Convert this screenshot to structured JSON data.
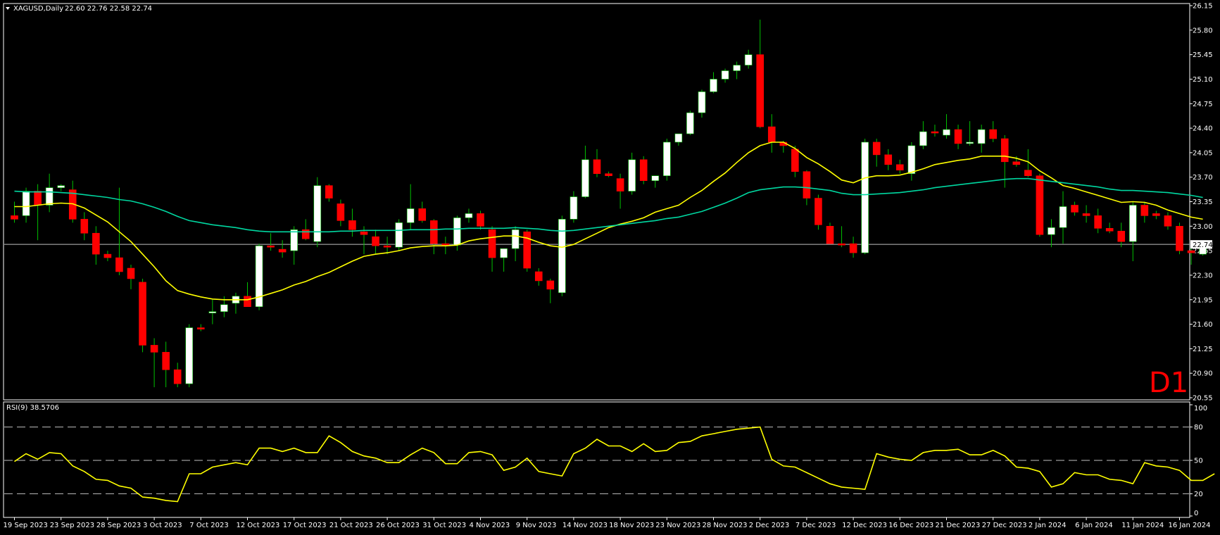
{
  "header": {
    "symbol_timeframe": "XAGUSD,Daily",
    "ohlc": "22.60 22.76 22.58 22.74"
  },
  "timeframe_badge": "D1",
  "colors": {
    "background": "#000000",
    "bull_body": "#ffffff",
    "bear_body": "#ff0000",
    "wick": "#00c000",
    "ma_fast": "#ffff00",
    "ma_slow": "#00d7a0",
    "rsi_line": "#ffff00",
    "axis_text": "#ffffff",
    "frame": "#ffffff",
    "price_line": "#c0c0c0",
    "badge": "#ff0000"
  },
  "chart_data": [
    {
      "type": "candlestick",
      "symbol": "XAGUSD",
      "timeframe": "Daily",
      "last_price": "22.74",
      "y_range": [
        20.55,
        26.15
      ],
      "y_ticks": [
        "26.15",
        "25.80",
        "25.45",
        "25.10",
        "24.75",
        "24.40",
        "24.05",
        "23.70",
        "23.35",
        "23.00",
        "22.65",
        "22.30",
        "21.95",
        "21.60",
        "21.25",
        "20.90",
        "20.55"
      ],
      "x_tick_labels": [
        {
          "index": 0,
          "label": "19 Sep 2023"
        },
        {
          "index": 4,
          "label": "23 Sep 2023"
        },
        {
          "index": 8,
          "label": "28 Sep 2023"
        },
        {
          "index": 12,
          "label": "3 Oct 2023"
        },
        {
          "index": 16,
          "label": "7 Oct 2023"
        },
        {
          "index": 20,
          "label": "12 Oct 2023"
        },
        {
          "index": 24,
          "label": "17 Oct 2023"
        },
        {
          "index": 28,
          "label": "21 Oct 2023"
        },
        {
          "index": 32,
          "label": "26 Oct 2023"
        },
        {
          "index": 36,
          "label": "31 Oct 2023"
        },
        {
          "index": 40,
          "label": "4 Nov 2023"
        },
        {
          "index": 44,
          "label": "9 Nov 2023"
        },
        {
          "index": 48,
          "label": "14 Nov 2023"
        },
        {
          "index": 52,
          "label": "18 Nov 2023"
        },
        {
          "index": 56,
          "label": "23 Nov 2023"
        },
        {
          "index": 60,
          "label": "28 Nov 2023"
        },
        {
          "index": 64,
          "label": "2 Dec 2023"
        },
        {
          "index": 68,
          "label": "7 Dec 2023"
        },
        {
          "index": 72,
          "label": "12 Dec 2023"
        },
        {
          "index": 76,
          "label": "16 Dec 2023"
        },
        {
          "index": 80,
          "label": "21 Dec 2023"
        },
        {
          "index": 84,
          "label": "27 Dec 2023"
        },
        {
          "index": 88,
          "label": "2 Jan 2024"
        },
        {
          "index": 92,
          "label": "6 Jan 2024"
        },
        {
          "index": 96,
          "label": "11 Jan 2024"
        },
        {
          "index": 100,
          "label": "16 Jan 2024"
        }
      ],
      "candles": [
        {
          "o": 23.15,
          "h": 23.35,
          "l": 23.05,
          "c": 23.1
        },
        {
          "o": 23.15,
          "h": 23.55,
          "l": 23.05,
          "c": 23.5
        },
        {
          "o": 23.5,
          "h": 23.6,
          "l": 22.8,
          "c": 23.3
        },
        {
          "o": 23.3,
          "h": 23.75,
          "l": 23.2,
          "c": 23.55
        },
        {
          "o": 23.55,
          "h": 23.6,
          "l": 23.5,
          "c": 23.58
        },
        {
          "o": 23.52,
          "h": 23.65,
          "l": 23.05,
          "c": 23.1
        },
        {
          "o": 23.1,
          "h": 23.2,
          "l": 22.8,
          "c": 22.9
        },
        {
          "o": 22.9,
          "h": 23.0,
          "l": 22.45,
          "c": 22.6
        },
        {
          "o": 22.6,
          "h": 22.65,
          "l": 22.5,
          "c": 22.55
        },
        {
          "o": 22.55,
          "h": 23.55,
          "l": 22.3,
          "c": 22.35
        },
        {
          "o": 22.4,
          "h": 22.45,
          "l": 22.1,
          "c": 22.25
        },
        {
          "o": 22.2,
          "h": 22.25,
          "l": 21.2,
          "c": 21.3
        },
        {
          "o": 21.3,
          "h": 21.4,
          "l": 20.7,
          "c": 21.2
        },
        {
          "o": 21.2,
          "h": 21.35,
          "l": 20.7,
          "c": 20.95
        },
        {
          "o": 20.95,
          "h": 21.05,
          "l": 20.7,
          "c": 20.75
        },
        {
          "o": 20.75,
          "h": 21.6,
          "l": 20.7,
          "c": 21.55
        },
        {
          "o": 21.55,
          "h": 21.6,
          "l": 21.5,
          "c": 21.53
        },
        {
          "o": 21.78,
          "h": 21.95,
          "l": 21.6,
          "c": 21.78
        },
        {
          "o": 21.78,
          "h": 22.0,
          "l": 21.7,
          "c": 21.88
        },
        {
          "o": 21.9,
          "h": 22.05,
          "l": 21.75,
          "c": 22.0
        },
        {
          "o": 22.0,
          "h": 22.2,
          "l": 21.85,
          "c": 21.85
        },
        {
          "o": 21.85,
          "h": 22.75,
          "l": 21.8,
          "c": 22.72
        },
        {
          "o": 22.72,
          "h": 22.9,
          "l": 22.65,
          "c": 22.7
        },
        {
          "o": 22.67,
          "h": 22.8,
          "l": 22.55,
          "c": 22.63
        },
        {
          "o": 22.65,
          "h": 23.0,
          "l": 22.45,
          "c": 22.95
        },
        {
          "o": 22.95,
          "h": 23.1,
          "l": 22.8,
          "c": 22.82
        },
        {
          "o": 22.78,
          "h": 23.7,
          "l": 22.7,
          "c": 23.58
        },
        {
          "o": 23.58,
          "h": 23.6,
          "l": 23.35,
          "c": 23.4
        },
        {
          "o": 23.32,
          "h": 23.38,
          "l": 23.0,
          "c": 23.08
        },
        {
          "o": 23.08,
          "h": 23.25,
          "l": 22.85,
          "c": 22.95
        },
        {
          "o": 22.92,
          "h": 23.0,
          "l": 22.6,
          "c": 22.88
        },
        {
          "o": 22.85,
          "h": 22.95,
          "l": 22.6,
          "c": 22.72
        },
        {
          "o": 22.72,
          "h": 22.85,
          "l": 22.6,
          "c": 22.7
        },
        {
          "o": 22.7,
          "h": 23.1,
          "l": 22.65,
          "c": 23.05
        },
        {
          "o": 23.05,
          "h": 23.6,
          "l": 22.95,
          "c": 23.25
        },
        {
          "o": 23.25,
          "h": 23.35,
          "l": 23.05,
          "c": 23.08
        },
        {
          "o": 23.08,
          "h": 23.1,
          "l": 22.6,
          "c": 22.75
        },
        {
          "o": 22.75,
          "h": 22.85,
          "l": 22.6,
          "c": 22.73
        },
        {
          "o": 22.73,
          "h": 23.15,
          "l": 22.65,
          "c": 23.12
        },
        {
          "o": 23.12,
          "h": 23.25,
          "l": 23.05,
          "c": 23.18
        },
        {
          "o": 23.18,
          "h": 23.22,
          "l": 22.95,
          "c": 23.0
        },
        {
          "o": 22.95,
          "h": 23.0,
          "l": 22.35,
          "c": 22.55
        },
        {
          "o": 22.55,
          "h": 22.65,
          "l": 22.35,
          "c": 22.68
        },
        {
          "o": 22.68,
          "h": 23.0,
          "l": 22.5,
          "c": 22.95
        },
        {
          "o": 22.92,
          "h": 22.95,
          "l": 22.35,
          "c": 22.4
        },
        {
          "o": 22.35,
          "h": 22.4,
          "l": 22.15,
          "c": 22.22
        },
        {
          "o": 22.22,
          "h": 22.25,
          "l": 21.9,
          "c": 22.1
        },
        {
          "o": 22.05,
          "h": 23.15,
          "l": 22.0,
          "c": 23.1
        },
        {
          "o": 23.1,
          "h": 23.5,
          "l": 23.05,
          "c": 23.42
        },
        {
          "o": 23.42,
          "h": 24.15,
          "l": 23.4,
          "c": 23.95
        },
        {
          "o": 23.95,
          "h": 24.1,
          "l": 23.7,
          "c": 23.75
        },
        {
          "o": 23.75,
          "h": 23.78,
          "l": 23.7,
          "c": 23.72
        },
        {
          "o": 23.68,
          "h": 23.75,
          "l": 23.25,
          "c": 23.5
        },
        {
          "o": 23.5,
          "h": 24.05,
          "l": 23.45,
          "c": 23.95
        },
        {
          "o": 23.95,
          "h": 24.0,
          "l": 23.6,
          "c": 23.65
        },
        {
          "o": 23.65,
          "h": 23.7,
          "l": 23.55,
          "c": 23.72
        },
        {
          "o": 23.72,
          "h": 24.25,
          "l": 23.65,
          "c": 24.2
        },
        {
          "o": 24.2,
          "h": 24.3,
          "l": 24.15,
          "c": 24.32
        },
        {
          "o": 24.32,
          "h": 24.65,
          "l": 24.3,
          "c": 24.62
        },
        {
          "o": 24.62,
          "h": 24.95,
          "l": 24.55,
          "c": 24.92
        },
        {
          "o": 24.92,
          "h": 25.2,
          "l": 24.9,
          "c": 25.1
        },
        {
          "o": 25.1,
          "h": 25.25,
          "l": 25.05,
          "c": 25.22
        },
        {
          "o": 25.22,
          "h": 25.35,
          "l": 25.1,
          "c": 25.3
        },
        {
          "o": 25.3,
          "h": 25.52,
          "l": 25.25,
          "c": 25.45
        },
        {
          "o": 25.45,
          "h": 25.95,
          "l": 24.4,
          "c": 24.42
        },
        {
          "o": 24.42,
          "h": 24.6,
          "l": 24.05,
          "c": 24.2
        },
        {
          "o": 24.2,
          "h": 24.22,
          "l": 24.05,
          "c": 24.15
        },
        {
          "o": 24.1,
          "h": 24.15,
          "l": 23.7,
          "c": 23.78
        },
        {
          "o": 23.78,
          "h": 23.8,
          "l": 23.3,
          "c": 23.4
        },
        {
          "o": 23.4,
          "h": 23.45,
          "l": 22.95,
          "c": 23.02
        },
        {
          "o": 23.0,
          "h": 23.05,
          "l": 22.75,
          "c": 22.75
        },
        {
          "o": 22.75,
          "h": 23.0,
          "l": 22.7,
          "c": 22.73
        },
        {
          "o": 22.75,
          "h": 22.85,
          "l": 22.55,
          "c": 22.62
        },
        {
          "o": 22.62,
          "h": 24.25,
          "l": 22.6,
          "c": 24.2
        },
        {
          "o": 24.2,
          "h": 24.25,
          "l": 23.85,
          "c": 24.02
        },
        {
          "o": 24.02,
          "h": 24.1,
          "l": 23.8,
          "c": 23.88
        },
        {
          "o": 23.88,
          "h": 23.95,
          "l": 23.75,
          "c": 23.8
        },
        {
          "o": 23.75,
          "h": 24.2,
          "l": 23.65,
          "c": 24.15
        },
        {
          "o": 24.15,
          "h": 24.5,
          "l": 24.1,
          "c": 24.35
        },
        {
          "o": 24.35,
          "h": 24.45,
          "l": 24.28,
          "c": 24.33
        },
        {
          "o": 24.3,
          "h": 24.6,
          "l": 24.25,
          "c": 24.38
        },
        {
          "o": 24.38,
          "h": 24.45,
          "l": 24.1,
          "c": 24.18
        },
        {
          "o": 24.2,
          "h": 24.5,
          "l": 24.15,
          "c": 24.2
        },
        {
          "o": 24.18,
          "h": 24.45,
          "l": 24.05,
          "c": 24.38
        },
        {
          "o": 24.38,
          "h": 24.5,
          "l": 24.2,
          "c": 24.25
        },
        {
          "o": 24.25,
          "h": 24.3,
          "l": 23.55,
          "c": 23.92
        },
        {
          "o": 23.92,
          "h": 24.0,
          "l": 23.85,
          "c": 23.88
        },
        {
          "o": 23.8,
          "h": 24.1,
          "l": 23.7,
          "c": 23.72
        },
        {
          "o": 23.72,
          "h": 23.75,
          "l": 22.85,
          "c": 22.88
        },
        {
          "o": 22.88,
          "h": 23.1,
          "l": 22.7,
          "c": 22.98
        },
        {
          "o": 22.98,
          "h": 23.5,
          "l": 22.75,
          "c": 23.28
        },
        {
          "o": 23.3,
          "h": 23.35,
          "l": 23.15,
          "c": 23.2
        },
        {
          "o": 23.18,
          "h": 23.3,
          "l": 23.05,
          "c": 23.15
        },
        {
          "o": 23.15,
          "h": 23.25,
          "l": 22.9,
          "c": 22.97
        },
        {
          "o": 22.97,
          "h": 23.05,
          "l": 22.9,
          "c": 22.93
        },
        {
          "o": 22.93,
          "h": 23.05,
          "l": 22.7,
          "c": 22.78
        },
        {
          "o": 22.78,
          "h": 23.35,
          "l": 22.5,
          "c": 23.3
        },
        {
          "o": 23.3,
          "h": 23.35,
          "l": 23.05,
          "c": 23.15
        },
        {
          "o": 23.18,
          "h": 23.22,
          "l": 23.1,
          "c": 23.15
        },
        {
          "o": 23.15,
          "h": 23.2,
          "l": 22.95,
          "c": 23.0
        },
        {
          "o": 23.0,
          "h": 23.05,
          "l": 22.6,
          "c": 22.65
        },
        {
          "o": 22.65,
          "h": 22.7,
          "l": 22.45,
          "c": 22.62
        },
        {
          "o": 22.6,
          "h": 22.76,
          "l": 22.58,
          "c": 22.74
        }
      ],
      "series": [
        {
          "values": [
            23.28,
            23.28,
            23.3,
            23.32,
            23.33,
            23.32,
            23.26,
            23.16,
            23.06,
            22.92,
            22.78,
            22.6,
            22.42,
            22.22,
            22.08,
            22.03,
            21.99,
            21.96,
            21.95,
            21.95,
            21.95,
            21.99,
            22.04,
            22.09,
            22.16,
            22.21,
            22.28,
            22.34,
            22.42,
            22.5,
            22.57,
            22.6,
            22.62,
            22.65,
            22.69,
            22.71,
            22.72,
            22.72,
            22.73,
            22.79,
            22.82,
            22.84,
            22.86,
            22.86,
            22.83,
            22.77,
            22.72,
            22.7,
            22.74,
            22.82,
            22.9,
            22.98,
            23.03,
            23.07,
            23.12,
            23.2,
            23.25,
            23.3,
            23.41,
            23.51,
            23.64,
            23.76,
            23.91,
            24.05,
            24.15,
            24.2,
            24.2,
            24.11,
            23.98,
            23.89,
            23.78,
            23.66,
            23.62,
            23.69,
            23.72,
            23.72,
            23.73,
            23.77,
            23.82,
            23.88,
            23.91,
            23.94,
            23.96,
            24.0,
            24.0,
            24.0,
            23.97,
            23.92,
            23.79,
            23.69,
            23.58,
            23.54,
            23.49,
            23.44,
            23.39,
            23.34,
            23.35,
            23.34,
            23.3,
            23.23,
            23.18,
            23.13,
            23.1
          ]
        },
        {
          "values": [
            23.5,
            23.49,
            23.49,
            23.49,
            23.48,
            23.47,
            23.45,
            23.43,
            23.41,
            23.38,
            23.36,
            23.32,
            23.27,
            23.21,
            23.14,
            23.08,
            23.05,
            23.02,
            23.0,
            22.98,
            22.95,
            22.93,
            22.92,
            22.92,
            22.92,
            22.92,
            22.92,
            22.92,
            22.93,
            22.93,
            22.94,
            22.94,
            22.94,
            22.94,
            22.95,
            22.95,
            22.95,
            22.96,
            22.96,
            22.97,
            22.97,
            22.97,
            22.97,
            22.98,
            22.97,
            22.96,
            22.94,
            22.93,
            22.94,
            22.96,
            22.98,
            23.0,
            23.02,
            23.04,
            23.06,
            23.08,
            23.11,
            23.13,
            23.17,
            23.21,
            23.27,
            23.33,
            23.4,
            23.48,
            23.52,
            23.54,
            23.56,
            23.56,
            23.55,
            23.53,
            23.51,
            23.47,
            23.45,
            23.45,
            23.46,
            23.47,
            23.48,
            23.5,
            23.52,
            23.55,
            23.57,
            23.59,
            23.61,
            23.63,
            23.65,
            23.67,
            23.68,
            23.68,
            23.66,
            23.64,
            23.62,
            23.6,
            23.58,
            23.56,
            23.53,
            23.51,
            23.51,
            23.5,
            23.49,
            23.48,
            23.46,
            23.44,
            23.41
          ]
        }
      ]
    },
    {
      "type": "line",
      "title": "RSI(9) 38.5706",
      "y_range": [
        0,
        100
      ],
      "y_ticks": [
        "100",
        "80",
        "50",
        "20",
        "0"
      ],
      "levels": [
        80,
        50,
        20
      ],
      "values": [
        49,
        56,
        51,
        57,
        56,
        45,
        40,
        33,
        32,
        27,
        25,
        17,
        16,
        14,
        13,
        38,
        38,
        44,
        46,
        48,
        46,
        61,
        61,
        58,
        61,
        57,
        57,
        72,
        66,
        58,
        54,
        52,
        48,
        48,
        55,
        61,
        57,
        47,
        47,
        57,
        58,
        55,
        41,
        44,
        52,
        40,
        38,
        36,
        56,
        61,
        69,
        63,
        63,
        58,
        65,
        58,
        59,
        66,
        67,
        72,
        74,
        76,
        78,
        79,
        80,
        51,
        45,
        44,
        39,
        34,
        29,
        26,
        25,
        24,
        56,
        53,
        51,
        50,
        57,
        59,
        59,
        60,
        55,
        55,
        59,
        54,
        44,
        43,
        40,
        26,
        29,
        39,
        37,
        37,
        33,
        32,
        29,
        48,
        45,
        44,
        41,
        32,
        32,
        38
      ]
    }
  ]
}
